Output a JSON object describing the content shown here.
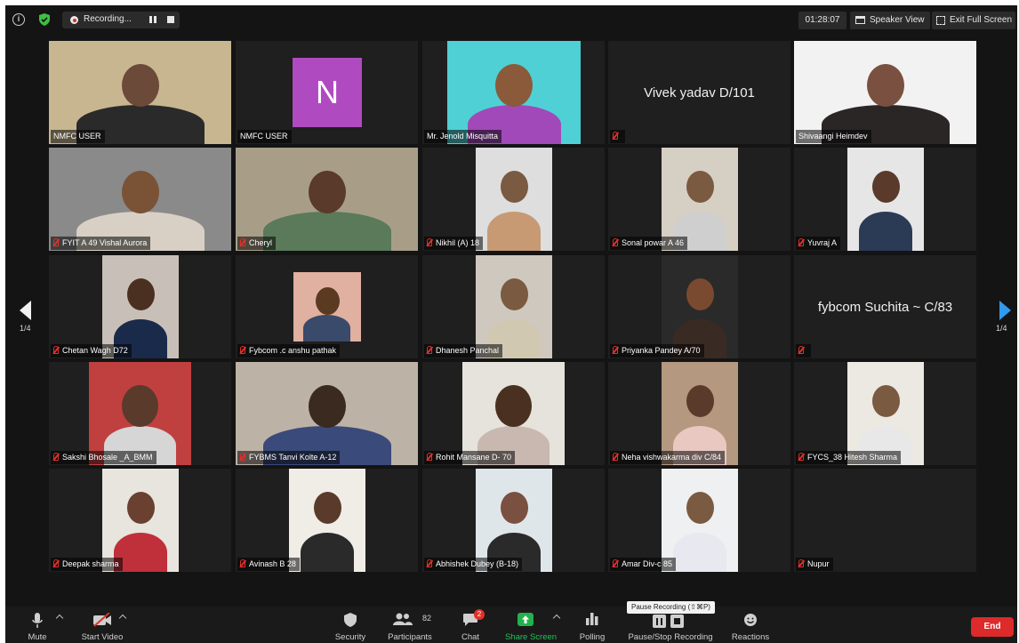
{
  "topbar": {
    "recording_label": "Recording...",
    "timer": "01:28:07",
    "speaker_view": "Speaker View",
    "exit_fullscreen": "Exit Full Screen"
  },
  "pagination": {
    "left": "1/4",
    "right": "1/4"
  },
  "participants": [
    {
      "name": "NMFC USER",
      "muted": false,
      "kind": "video",
      "active": true
    },
    {
      "name": "NMFC USER",
      "muted": false,
      "kind": "avatar",
      "initial": "N"
    },
    {
      "name": "Mr. Jenold Misquitta",
      "muted": false,
      "kind": "video"
    },
    {
      "name": "Vivek yadav D/101",
      "muted": true,
      "kind": "text"
    },
    {
      "name": "Shivaangi Heimdev",
      "muted": false,
      "kind": "video"
    },
    {
      "name": "FYIT A 49 Vishal Aurora",
      "muted": true,
      "kind": "video"
    },
    {
      "name": "Cheryl",
      "muted": true,
      "kind": "video"
    },
    {
      "name": "Nikhil (A) 18",
      "muted": true,
      "kind": "video"
    },
    {
      "name": "Sonal powar A 46",
      "muted": true,
      "kind": "video"
    },
    {
      "name": "Yuvraj A",
      "muted": true,
      "kind": "video"
    },
    {
      "name": "Chetan Wagh D72",
      "muted": true,
      "kind": "video"
    },
    {
      "name": "Fybcom .c anshu pathak",
      "muted": true,
      "kind": "video"
    },
    {
      "name": "Dhanesh Panchal",
      "muted": true,
      "kind": "video"
    },
    {
      "name": "Priyanka Pandey A/70",
      "muted": true,
      "kind": "video"
    },
    {
      "name": "fybcom Suchita ~ C/83",
      "muted": true,
      "kind": "text"
    },
    {
      "name": "Sakshi Bhosale _A_BMM",
      "muted": true,
      "kind": "video"
    },
    {
      "name": "FYBMS Tanvi Kolte A-12",
      "muted": true,
      "kind": "video"
    },
    {
      "name": "Rohit Mansane D- 70",
      "muted": true,
      "kind": "video"
    },
    {
      "name": "Neha vishwakarma div C/84",
      "muted": true,
      "kind": "video"
    },
    {
      "name": "FYCS_38 Hitesh Sharma",
      "muted": true,
      "kind": "video"
    },
    {
      "name": "Deepak sharma",
      "muted": true,
      "kind": "video"
    },
    {
      "name": "Avinash B 28",
      "muted": true,
      "kind": "video"
    },
    {
      "name": "Abhishek Dubey (B-18)",
      "muted": true,
      "kind": "video"
    },
    {
      "name": "Amar Div-c 85",
      "muted": true,
      "kind": "video"
    },
    {
      "name": "Nupur",
      "muted": true,
      "kind": "text-empty"
    }
  ],
  "toolbar": {
    "mute": "Mute",
    "start_video": "Start Video",
    "security": "Security",
    "participants": "Participants",
    "participants_count": "82",
    "chat": "Chat",
    "chat_badge": "2",
    "share_screen": "Share Screen",
    "polling": "Polling",
    "pause_stop": "Pause/Stop Recording",
    "reactions": "Reactions",
    "end": "End",
    "pause_tooltip": "Pause Recording (⇧⌘P)"
  },
  "colors": {
    "active_speaker": "#d6e04a",
    "avatar_bg": "#b04ac1",
    "end_button": "#dd2a2a",
    "share_green": "#22b14c",
    "next_arrow": "#2f9bf0"
  }
}
